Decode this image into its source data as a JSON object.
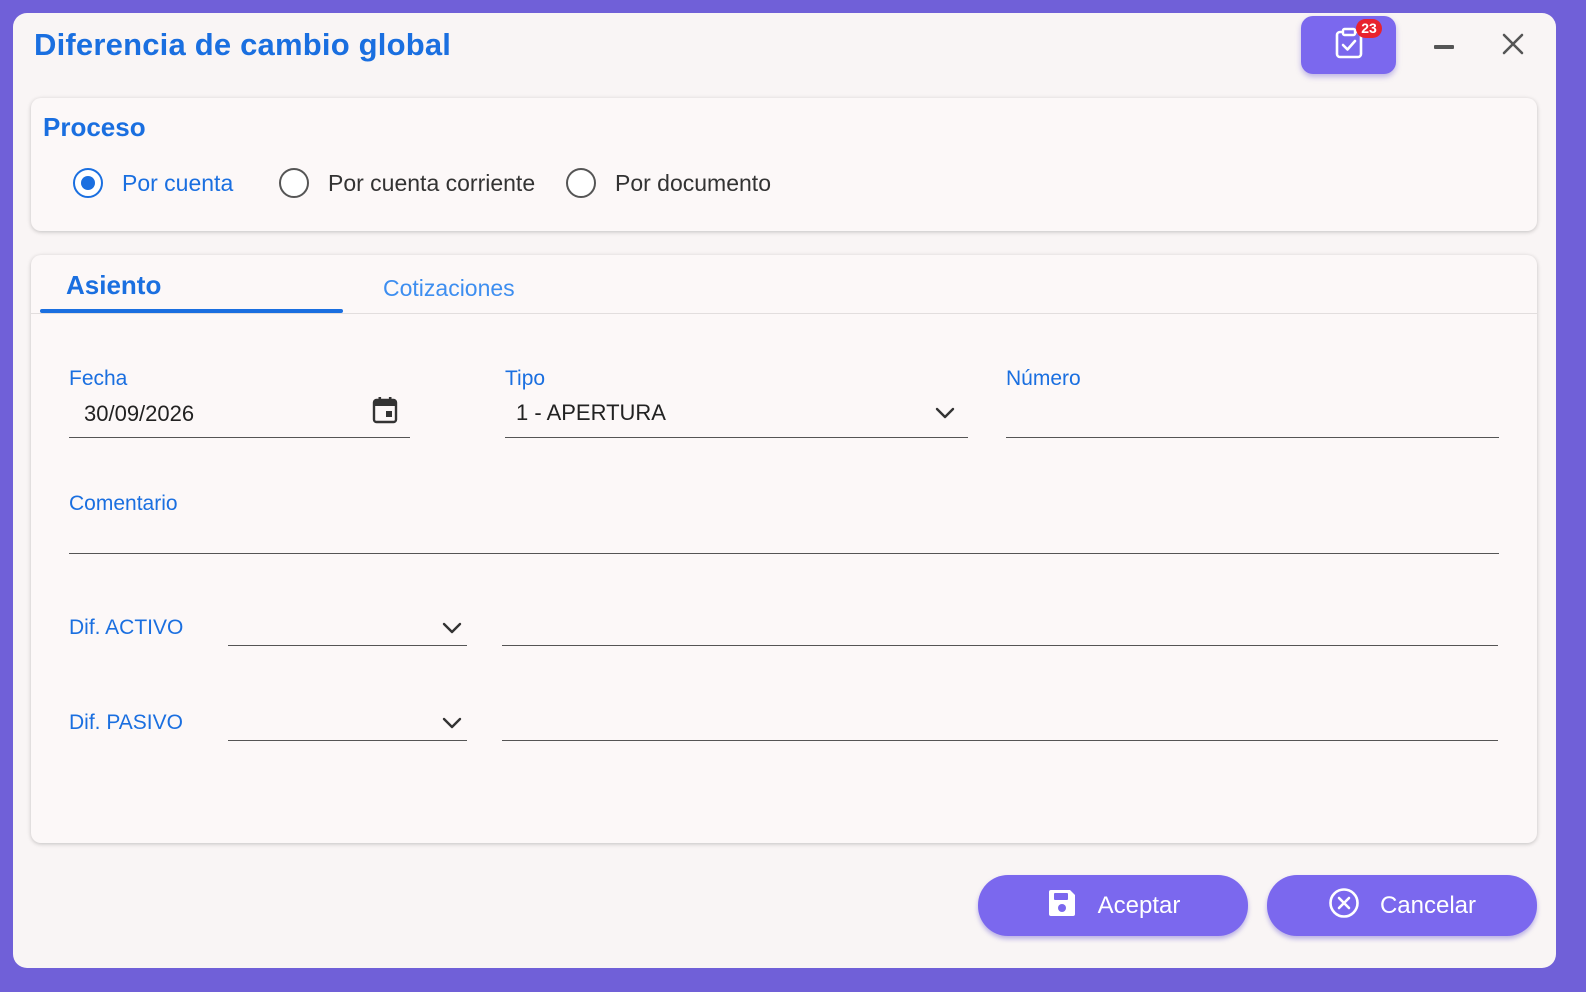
{
  "window": {
    "title": "Diferencia de cambio global",
    "tasks_badge": "23",
    "controls": [
      "minimize-icon",
      "close-icon"
    ]
  },
  "proceso": {
    "title": "Proceso",
    "options": [
      {
        "label": "Por cuenta",
        "checked": true
      },
      {
        "label": "Por cuenta corriente",
        "checked": false
      },
      {
        "label": "Por documento",
        "checked": false
      }
    ]
  },
  "tabs": [
    {
      "label": "Asiento",
      "active": true
    },
    {
      "label": "Cotizaciones",
      "active": false
    }
  ],
  "asiento": {
    "fecha": {
      "label": "Fecha",
      "value": "30/09/2026"
    },
    "tipo": {
      "label": "Tipo",
      "value": "1 - APERTURA"
    },
    "numero": {
      "label": "Número",
      "value": ""
    },
    "comentario": {
      "label": "Comentario",
      "value": ""
    },
    "dif_activo": {
      "label": "Dif. ACTIVO",
      "value": "",
      "description": ""
    },
    "dif_pasivo": {
      "label": "Dif. PASIVO",
      "value": "",
      "description": ""
    }
  },
  "actions": {
    "accept_label": "Aceptar",
    "cancel_label": "Cancelar"
  },
  "colors": {
    "accent": "#1a6fe0",
    "button": "#7b68ee",
    "frame": "#7060d8",
    "badge": "#e8222e"
  }
}
